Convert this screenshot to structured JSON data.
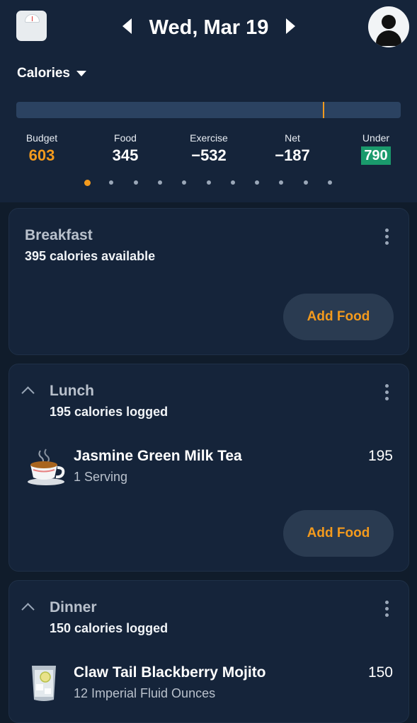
{
  "header": {
    "date": "Wed, Mar 19",
    "icons": [
      "scale-icon",
      "chevron-left-icon",
      "chevron-right-icon",
      "user-avatar-icon"
    ]
  },
  "summary": {
    "selector_label": "Calories",
    "progress_fraction": 0.8,
    "stats": [
      {
        "label": "Budget",
        "value": "603"
      },
      {
        "label": "Food",
        "value": "345"
      },
      {
        "label": "Exercise",
        "value": "−532"
      },
      {
        "label": "Net",
        "value": "−187"
      },
      {
        "label": "Under",
        "value": "790"
      }
    ],
    "pager": {
      "count": 11,
      "active": 0
    }
  },
  "meals": {
    "breakfast": {
      "title": "Breakfast",
      "subtitle": "395 calories available",
      "add_label": "Add Food"
    },
    "lunch": {
      "title": "Lunch",
      "subtitle": "195 calories logged",
      "add_label": "Add Food",
      "items": [
        {
          "name": "Jasmine Green Milk Tea",
          "serving": "1 Serving",
          "calories": "195",
          "icon": "tea-cup-icon"
        }
      ]
    },
    "dinner": {
      "title": "Dinner",
      "subtitle": "150 calories logged",
      "items": [
        {
          "name": "Claw Tail Blackberry Mojito",
          "serving": "12 Imperial Fluid Ounces",
          "calories": "150",
          "icon": "cocktail-glass-icon"
        }
      ]
    }
  },
  "colors": {
    "accent": "#f39a1d",
    "under_badge": "#1a9a6c",
    "background": "#101c2b",
    "panel": "#15243a"
  }
}
